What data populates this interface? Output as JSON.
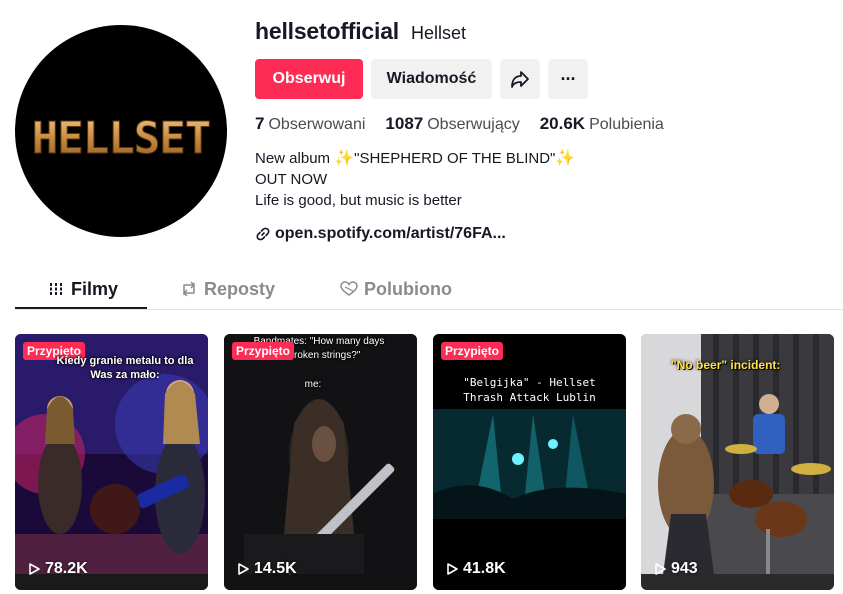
{
  "profile": {
    "username": "hellsetofficial",
    "nickname": "Hellset",
    "avatar_text": "HELLSET"
  },
  "actions": {
    "follow_label": "Obserwuj",
    "message_label": "Wiadomość",
    "share_icon": "share-icon",
    "more_icon": "more-icon",
    "more_glyph": "···"
  },
  "stats": {
    "following_count": "7",
    "following_label": "Obserwowani",
    "followers_count": "1087",
    "followers_label": "Obserwujący",
    "likes_count": "20.6K",
    "likes_label": "Polubienia"
  },
  "bio": {
    "line1_pre": "New album ",
    "line1_title": "\"SHEPHERD OF THE BLIND\"",
    "line2": "OUT NOW",
    "line3": "Life is good, but music is better",
    "sparkle": "✨"
  },
  "link": {
    "text": "open.spotify.com/artist/76FA..."
  },
  "tabs": [
    {
      "label": "Filmy",
      "icon": "grid-icon",
      "active": true
    },
    {
      "label": "Reposty",
      "icon": "repost-icon",
      "active": false
    },
    {
      "label": "Polubiono",
      "icon": "heart-icon",
      "active": false
    }
  ],
  "videos": [
    {
      "pinned_label": "Przypięto",
      "views": "78.2K",
      "caption": "Kiedy granie metalu to dla Was za mało:"
    },
    {
      "pinned_label": "Przypięto",
      "views": "14.5K",
      "caption": "Bandmates: \"How many days ...oken strings?\"",
      "caption_line1": "Bandmates: \"How many days",
      "caption_line2": "roken strings?\"",
      "caption_line3": "me:"
    },
    {
      "pinned_label": "Przypięto",
      "views": "41.8K",
      "caption_line1": "\"Belgijka\" - Hellset",
      "caption_line2": "Thrash Attack Lublin"
    },
    {
      "pinned_label": "",
      "views": "943",
      "caption": "\"No beer\" incident:"
    }
  ],
  "colors": {
    "accent": "#fe2c55",
    "button_gray": "#f1f1f2",
    "text": "#161823",
    "muted": "#8a8b91"
  }
}
